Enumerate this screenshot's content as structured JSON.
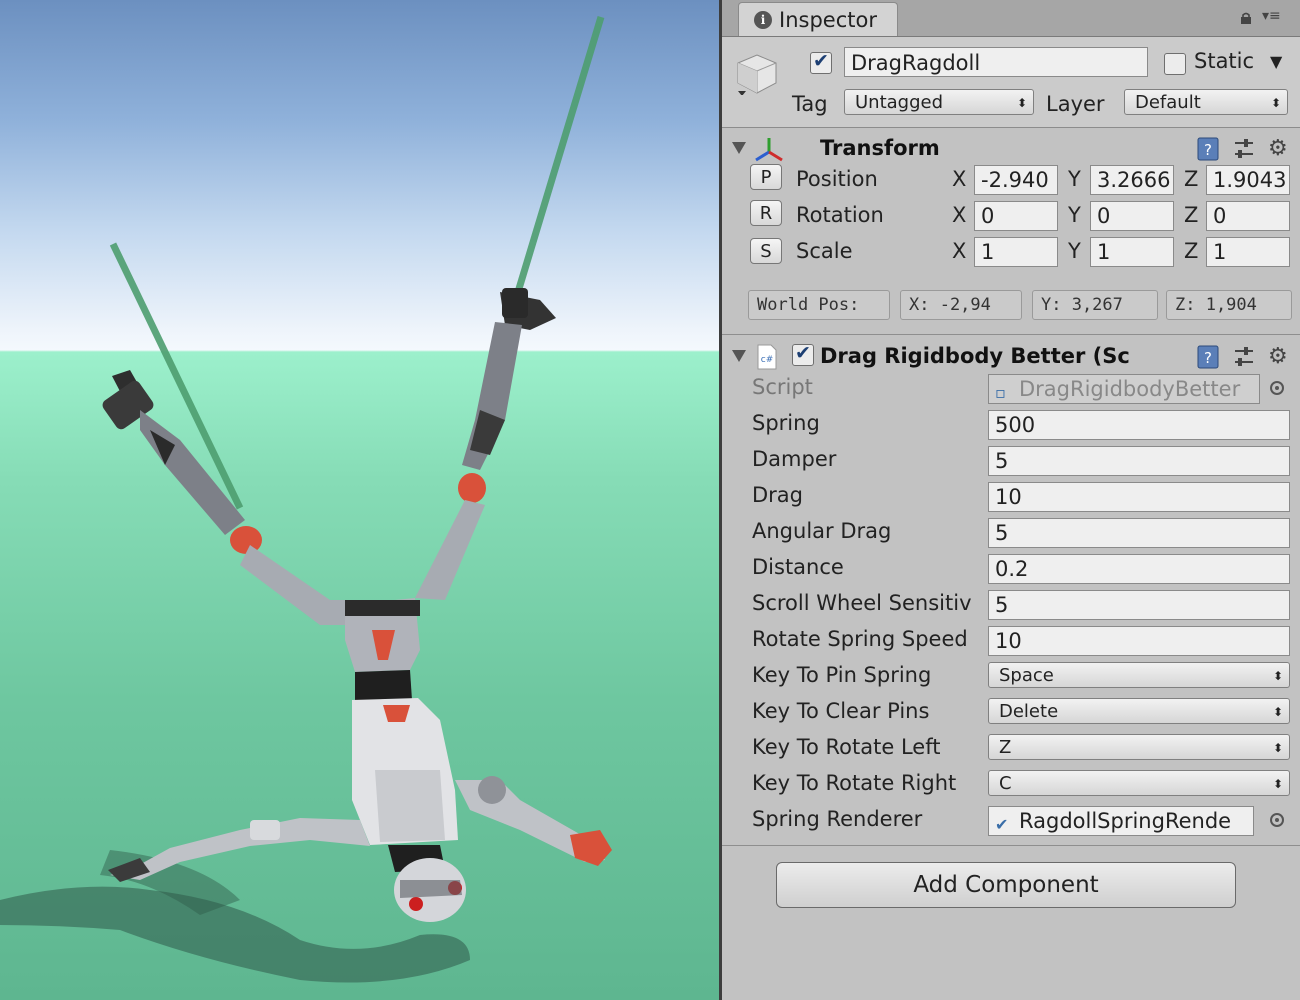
{
  "inspector": {
    "tab_label": "Inspector",
    "object_name": "DragRagdoll",
    "active": true,
    "static_label": "Static",
    "static_checked": false,
    "tag_label": "Tag",
    "tag_value": "Untagged",
    "layer_label": "Layer",
    "layer_value": "Default"
  },
  "transform": {
    "title": "Transform",
    "rows": [
      {
        "button": "P",
        "label": "Position",
        "x": "-2.940",
        "y": "3.2666",
        "z": "1.9043"
      },
      {
        "button": "R",
        "label": "Rotation",
        "x": "0",
        "y": "0",
        "z": "0"
      },
      {
        "button": "S",
        "label": "Scale",
        "x": "1",
        "y": "1",
        "z": "1"
      }
    ],
    "axis_labels": {
      "x": "X",
      "y": "Y",
      "z": "Z"
    },
    "world_pos": {
      "label": "World Pos:",
      "x": "X: -2,94",
      "y": "Y: 3,267",
      "z": "Z: 1,904"
    }
  },
  "component": {
    "title": "Drag Rigidbody Better (Sc",
    "cs_badge": "c#",
    "enabled": true,
    "script_label": "Script",
    "script_value": "DragRigidbodyBetter",
    "fields": [
      {
        "label": "Spring",
        "value": "500"
      },
      {
        "label": "Damper",
        "value": "5"
      },
      {
        "label": "Drag",
        "value": "10"
      },
      {
        "label": "Angular Drag",
        "value": "5"
      },
      {
        "label": "Distance",
        "value": "0.2"
      },
      {
        "label": "Scroll Wheel Sensitiv",
        "value": "5"
      },
      {
        "label": "Rotate Spring Speed",
        "value": "10"
      }
    ],
    "dropdowns": [
      {
        "label": "Key To Pin Spring",
        "value": "Space"
      },
      {
        "label": "Key To Clear Pins",
        "value": "Delete"
      },
      {
        "label": "Key To Rotate Left",
        "value": "Z"
      },
      {
        "label": "Key To Rotate Right",
        "value": "C"
      }
    ],
    "spring_renderer_label": "Spring Renderer",
    "spring_renderer_value": "RagdollSpringRende"
  },
  "add_component_label": "Add Component",
  "icons": {
    "info": "info-icon",
    "lock": "lock-icon",
    "menu": "menu-icon",
    "gameobject": "cube-icon",
    "transform": "transform-axes-icon",
    "help": "help-book-icon",
    "presets": "sliders-icon",
    "settings": "gear-icon",
    "script": "script-icon",
    "object_picker": "object-picker-icon"
  },
  "colors": {
    "spring_line": "#4e9e70",
    "sky_top": "#6c90c0",
    "ground": "#86dcb6",
    "inspector_bg": "#c2c2c2",
    "robot_accent": "#e0553b"
  }
}
